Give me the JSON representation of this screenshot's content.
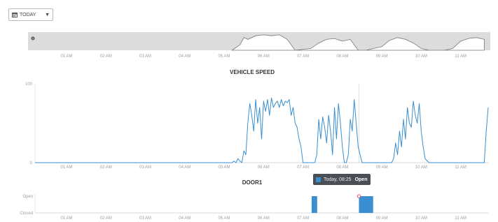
{
  "toolbar": {
    "period_label": "TODAY",
    "calendar_icon": "calendar-icon",
    "caret_icon": "caret-down-icon"
  },
  "overview": {
    "info_icon": "info-icon"
  },
  "time_axis": [
    "01 AM",
    "02 AM",
    "03 AM",
    "04 AM",
    "05 AM",
    "06 AM",
    "07 AM",
    "08 AM",
    "09 AM",
    "10 AM",
    "11 AM"
  ],
  "tooltip": {
    "time": "Today, 08:25",
    "value": "Open"
  },
  "colors": {
    "series": "#3a8fd0",
    "overview_fill": "#dcdcdc",
    "tooltip_bg": "#4a4f55",
    "marker": "#e05050"
  },
  "chart_data": [
    {
      "type": "area",
      "title": "",
      "description": "overview navigator",
      "x_unit": "hour",
      "xlim": [
        0.2,
        11.7
      ],
      "x": [
        5.2,
        5.4,
        5.5,
        5.6,
        5.8,
        6.0,
        6.2,
        6.4,
        6.6,
        6.8,
        7.2,
        7.4,
        7.6,
        7.8,
        8.0,
        8.2,
        8.4,
        8.6,
        9.0,
        9.2,
        9.4,
        9.6,
        9.8,
        10.0,
        10.2,
        10.6,
        10.8,
        11.0,
        11.2,
        11.4,
        11.6
      ],
      "values": [
        0,
        30,
        70,
        60,
        80,
        85,
        80,
        85,
        60,
        0,
        10,
        40,
        60,
        65,
        50,
        60,
        0,
        0,
        20,
        55,
        70,
        60,
        40,
        10,
        0,
        0,
        10,
        50,
        65,
        70,
        60
      ]
    },
    {
      "type": "line",
      "title": "VEHICLE SPEED",
      "ylim": [
        0,
        100
      ],
      "yticks": [
        "0",
        "100"
      ],
      "x_unit": "hour",
      "xlim": [
        0.2,
        11.7
      ],
      "x": [
        5.1,
        5.2,
        5.25,
        5.3,
        5.35,
        5.4,
        5.45,
        5.5,
        5.55,
        5.6,
        5.65,
        5.7,
        5.75,
        5.8,
        5.85,
        5.9,
        5.95,
        6.0,
        6.05,
        6.1,
        6.15,
        6.2,
        6.25,
        6.3,
        6.35,
        6.4,
        6.45,
        6.5,
        6.55,
        6.6,
        6.65,
        6.7,
        6.75,
        6.8,
        6.85,
        6.9,
        6.95,
        7.0,
        7.1,
        7.2,
        7.3,
        7.35,
        7.4,
        7.45,
        7.5,
        7.55,
        7.6,
        7.65,
        7.7,
        7.75,
        7.8,
        7.85,
        7.9,
        7.95,
        8.0,
        8.05,
        8.1,
        8.15,
        8.2,
        8.25,
        8.3,
        8.35,
        8.4,
        8.5,
        8.6,
        8.7,
        8.8,
        8.9,
        9.0,
        9.05,
        9.1,
        9.15,
        9.2,
        9.25,
        9.3,
        9.35,
        9.4,
        9.45,
        9.5,
        9.55,
        9.6,
        9.65,
        9.7,
        9.75,
        9.8,
        9.85,
        9.9,
        9.95,
        10.0,
        10.05,
        10.1,
        10.2,
        10.3,
        10.4,
        10.5,
        10.6,
        10.7,
        10.8,
        10.9,
        11.0,
        11.1,
        11.2,
        11.3,
        11.4,
        11.5,
        11.55,
        11.6,
        11.65,
        11.7
      ],
      "values": [
        0,
        0,
        2,
        0,
        5,
        2,
        0,
        15,
        10,
        50,
        75,
        60,
        40,
        80,
        50,
        70,
        30,
        78,
        65,
        80,
        60,
        82,
        70,
        75,
        78,
        70,
        80,
        72,
        78,
        76,
        80,
        60,
        70,
        50,
        45,
        30,
        20,
        0,
        0,
        0,
        0,
        10,
        55,
        30,
        58,
        45,
        25,
        60,
        40,
        10,
        70,
        30,
        75,
        50,
        20,
        0,
        0,
        10,
        55,
        40,
        80,
        50,
        20,
        0,
        0,
        0,
        0,
        0,
        0,
        0,
        0,
        0,
        0,
        0,
        5,
        25,
        10,
        40,
        20,
        55,
        30,
        70,
        50,
        45,
        78,
        60,
        50,
        75,
        40,
        20,
        5,
        0,
        0,
        0,
        0,
        0,
        0,
        0,
        0,
        0,
        0,
        0,
        0,
        0,
        0,
        0,
        0,
        40,
        70,
        80,
        75
      ]
    },
    {
      "type": "bar",
      "title": "DOOR1",
      "yticks": [
        "Closed",
        "Open"
      ],
      "x_unit": "hour",
      "xlim": [
        0.2,
        11.7
      ],
      "segments": [
        {
          "start": 7.22,
          "end": 7.36,
          "value": "Open"
        },
        {
          "start": 8.42,
          "end": 8.78,
          "value": "Open"
        }
      ],
      "marker_x": 8.42
    }
  ]
}
